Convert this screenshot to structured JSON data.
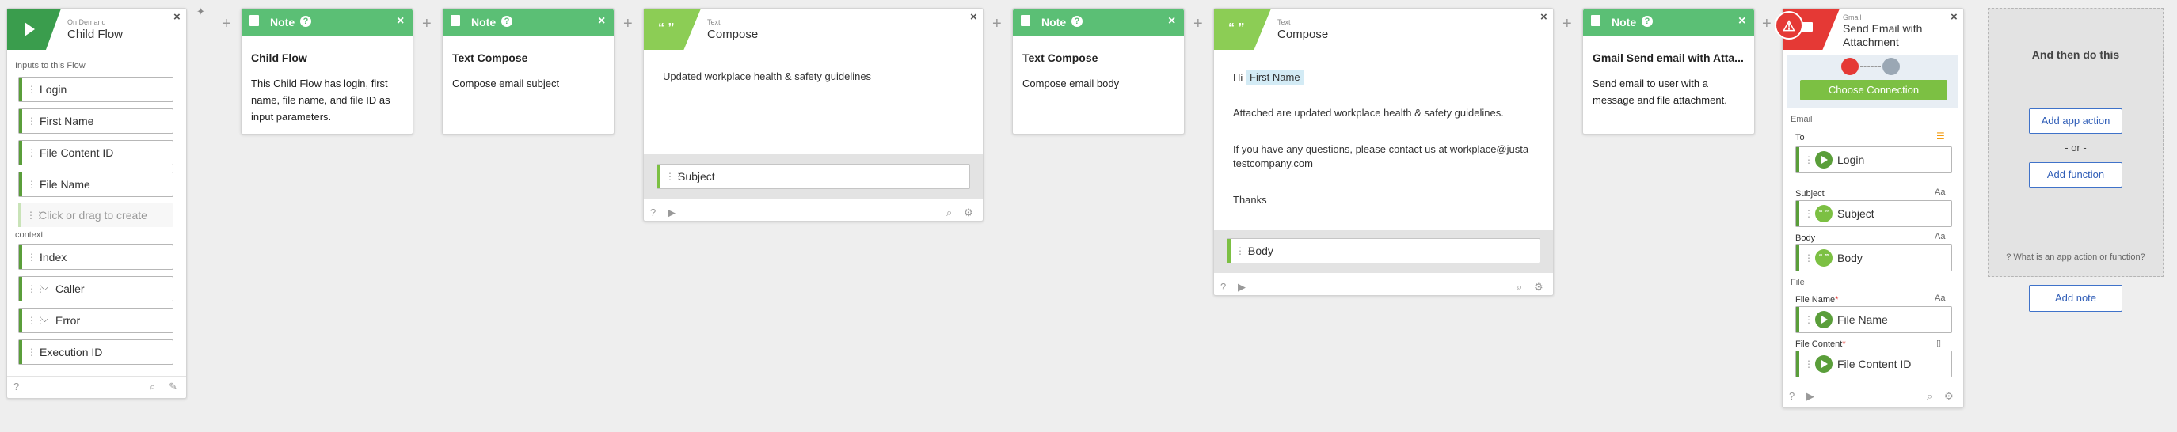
{
  "colors": {
    "green": "#5bbf75",
    "dark_green": "#5a9e3a",
    "light_green": "#7cc043",
    "blue": "#3f72c9",
    "red": "#e53935"
  },
  "trigger": {
    "type": "On Demand",
    "title": "Child Flow",
    "inputs_label": "Inputs to this Flow",
    "inputs": [
      "Login",
      "First Name",
      "File Content ID",
      "File Name"
    ],
    "create_placeholder": "Click or drag to create",
    "context_label": "context",
    "context": [
      "Index",
      "Caller",
      "Error",
      "Execution ID"
    ]
  },
  "notes": [
    {
      "header": "Note",
      "title": "Child Flow",
      "body": "This Child Flow has login, first name, file name, and file ID as input parameters."
    },
    {
      "header": "Note",
      "title": "Text Compose",
      "body": "Compose email subject"
    },
    {
      "header": "Note",
      "title": "Text Compose",
      "body": "Compose email body"
    },
    {
      "header": "Note",
      "title": "Gmail Send email with Atta...",
      "body": "Send email to user with a message and file attachment."
    }
  ],
  "compose1": {
    "type": "Text",
    "title": "Compose",
    "text": "Updated workplace health & safety guidelines",
    "output": "Subject"
  },
  "compose2": {
    "type": "Text",
    "title": "Compose",
    "greeting": "Hi",
    "token": "First Name",
    "line1": "Attached are updated workplace health & safety guidelines.",
    "line2a": "If you have any questions, please contact us at  workplace@justa",
    "line2b": "testcompany.com",
    "line3": "Thanks",
    "output": "Body"
  },
  "gmail": {
    "app": "Gmail",
    "title_line1": "Send Email with",
    "title_line2": "Attachment",
    "connect": "Choose Connection",
    "email_label": "Email",
    "to_label": "To",
    "to_value": "Login",
    "subject_label": "Subject",
    "subject_value": "Subject",
    "body_label": "Body",
    "body_value": "Body",
    "file_label": "File",
    "file_name_label": "File Name",
    "file_name_value": "File Name",
    "file_content_label": "File Content",
    "file_content_value": "File Content ID",
    "type_label": "Aa"
  },
  "next": {
    "title": "And then do this",
    "add_action": "Add app action",
    "or": "- or -",
    "add_function": "Add function",
    "help": "What is an app action or function?",
    "add_note": "Add note"
  }
}
